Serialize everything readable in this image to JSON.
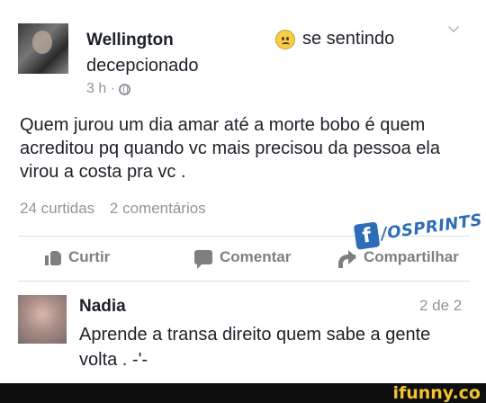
{
  "post": {
    "author": "Wellington",
    "feeling_prefix": "se sentindo",
    "feeling": "decepcionado",
    "feeling_icon": "sad-face-icon",
    "time": "3 h ·",
    "text": "Quem jurou um dia amar até a morte bobo é quem acreditou pq quando vc mais  precisou da pessoa ela virou a costa pra vc .",
    "likes": "24 curtidas",
    "comments": "2 comentários"
  },
  "actions": {
    "like": "Curtir",
    "comment": "Comentar",
    "share": "Compartilhar"
  },
  "watermark": {
    "logo": "f",
    "text": "/OSPRINTS"
  },
  "comment": {
    "author": "Nadia",
    "counter": "2 de 2",
    "text": "Aprende a transa direito quem sabe a gente volta .  -'-"
  },
  "footer": {
    "brand": "ifunny.co"
  },
  "colors": {
    "text": "#1d2129",
    "muted": "#90949c",
    "action": "#7f7f7f",
    "watermark": "#2d6db5",
    "brand": "#f2c230"
  }
}
